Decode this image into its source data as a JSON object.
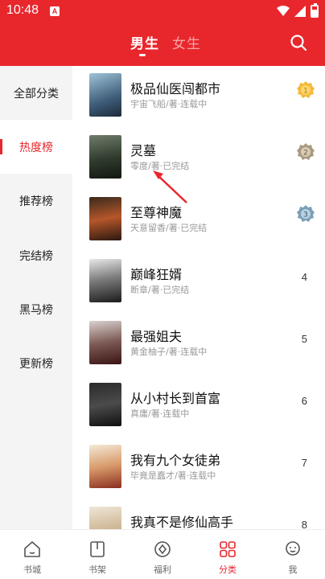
{
  "status": {
    "time": "10:48",
    "badge": "A"
  },
  "header": {
    "tabs": [
      "男生",
      "女生"
    ],
    "active_tab": "男生"
  },
  "sidebar": {
    "items": [
      {
        "label": "全部分类"
      },
      {
        "label": "热度榜",
        "active": true
      },
      {
        "label": "推荐榜"
      },
      {
        "label": "完结榜"
      },
      {
        "label": "黑马榜"
      },
      {
        "label": "更新榜"
      }
    ]
  },
  "books": [
    {
      "title": "极品仙医闯都市",
      "meta": "宇宙飞船/著·连载中",
      "rank": "1",
      "medal": "gold"
    },
    {
      "title": "灵墓",
      "meta": "零度/著·已完结",
      "rank": "2",
      "medal": "silver"
    },
    {
      "title": "至尊神魔",
      "meta": "天意留香/著·已完结",
      "rank": "3",
      "medal": "bronze"
    },
    {
      "title": "巅峰狂婿",
      "meta": "断章/著·已完结",
      "rank": "4"
    },
    {
      "title": "最强姐夫",
      "meta": "黄金柚子/著·连载中",
      "rank": "5"
    },
    {
      "title": "从小村长到首富",
      "meta": "真庸/著·连载中",
      "rank": "6"
    },
    {
      "title": "我有九个女徒弟",
      "meta": "毕竟是蠢才/著·连载中",
      "rank": "7"
    },
    {
      "title": "我真不是修仙高手",
      "meta": "",
      "rank": "8"
    }
  ],
  "bottom_nav": [
    {
      "label": "书城"
    },
    {
      "label": "书架"
    },
    {
      "label": "福利"
    },
    {
      "label": "分类",
      "active": true
    },
    {
      "label": "我"
    }
  ],
  "colors": {
    "accent": "#e8272d"
  }
}
